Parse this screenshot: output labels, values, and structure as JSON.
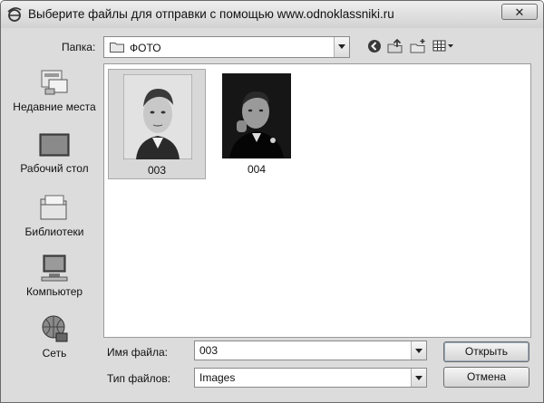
{
  "window": {
    "title": "Выберите файлы для отправки с помощью www.odnoklassniki.ru",
    "close_symbol": "✕"
  },
  "location": {
    "label": "Папка:",
    "current": "ФОТО"
  },
  "toolbar": {
    "icons": [
      "back-icon",
      "up-folder-icon",
      "new-folder-icon",
      "view-menu-icon"
    ]
  },
  "places": [
    {
      "label": "Недавние места",
      "icon": "recent-places-icon"
    },
    {
      "label": "Рабочий стол",
      "icon": "desktop-icon"
    },
    {
      "label": "Библиотеки",
      "icon": "libraries-icon"
    },
    {
      "label": "Компьютер",
      "icon": "computer-icon"
    },
    {
      "label": "Сеть",
      "icon": "network-icon"
    }
  ],
  "files": [
    {
      "name": "003",
      "selected": true
    },
    {
      "name": "004",
      "selected": false
    }
  ],
  "filename": {
    "label": "Имя файла:",
    "value": "003"
  },
  "filetype": {
    "label": "Тип файлов:",
    "value": "Images"
  },
  "buttons": {
    "open": "Открыть",
    "cancel": "Отмена"
  }
}
